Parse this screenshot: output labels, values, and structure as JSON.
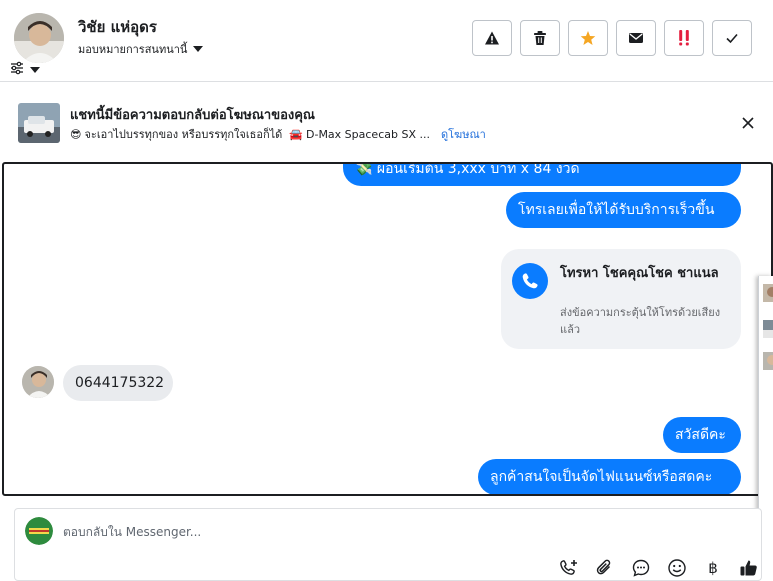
{
  "header": {
    "contact_name": "วิชัย แห่อุดร",
    "assign_label": "มอบหมายการสนทนานี้",
    "actions": [
      {
        "name": "report-spam",
        "icon": "warning-icon"
      },
      {
        "name": "delete",
        "icon": "trash-icon"
      },
      {
        "name": "star",
        "icon": "star-icon"
      },
      {
        "name": "mark-unread",
        "icon": "envelope-icon"
      },
      {
        "name": "follow-up",
        "icon": "double-exclamation-icon"
      },
      {
        "name": "mark-done",
        "icon": "check-icon"
      }
    ],
    "accent_star": "#f5a623",
    "accent_flag": "#e41e3f"
  },
  "ad_banner": {
    "title": "แชทนี้มีข้อความตอบกลับต่อโฆษณาของคุณ",
    "subtitle_emoji": "😎",
    "subtitle_text": "จะเอาไปบรรทุกของ หรือบรรทุกใจเธอก็ได้",
    "car_emoji": "🚘",
    "model_text": "D-Max Spacecab SX ...",
    "link": "ดูโฆษณา"
  },
  "messages": {
    "out_1": "💸 ผ่อนเริ่มต้น 3,xxx บาท x 84 งวด",
    "out_2": "โทรเลยเพื่อให้ได้รับบริการเร็วขึ้น",
    "call_card": {
      "title": "โทรหา โชคคุณโชค ชาแนล",
      "subtitle": "ส่งข้อความกระตุ้นให้โทรด้วยเสียงแล้ว"
    },
    "in_1": "0644175322",
    "out_3": "สวัสดีคะ",
    "out_4": "ลูกค้าสนใจเป็นจัดไฟแนนซ์หรือสดคะ"
  },
  "composer": {
    "placeholder": "ตอบกลับใน Messenger..."
  },
  "colors": {
    "outgoing_bubble": "#0a7cff",
    "incoming_bubble": "#e9ebee",
    "link": "#216fdb"
  }
}
